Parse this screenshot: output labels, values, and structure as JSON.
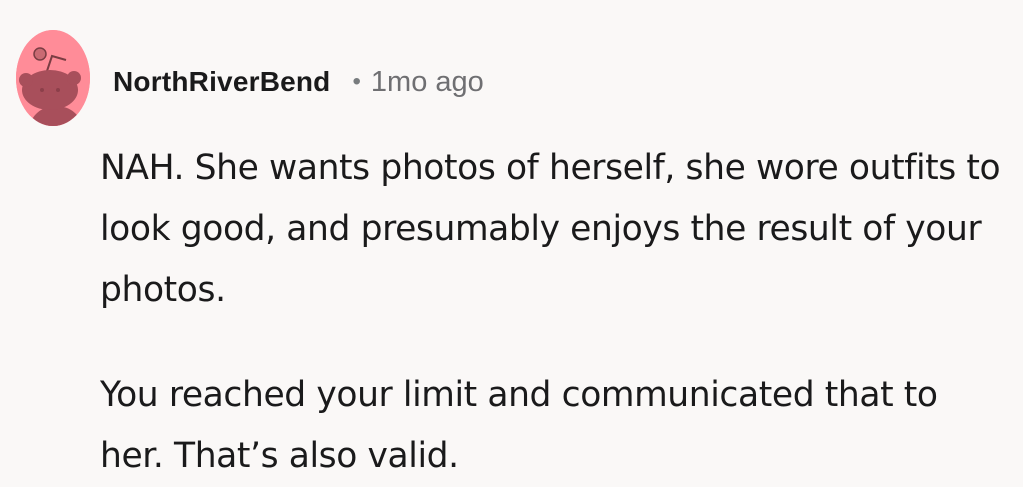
{
  "comment": {
    "author": "NorthRiverBend",
    "separator": "•",
    "timestamp": "1mo ago",
    "avatar_icon": "snoo-avatar-icon",
    "avatar_color": "#ff8c98",
    "paragraphs": [
      "NAH. She wants photos of herself, she wore outfits to look good, and presumably enjoys the result of your photos.",
      "You reached your limit and communicated that to her. That’s also valid."
    ]
  }
}
